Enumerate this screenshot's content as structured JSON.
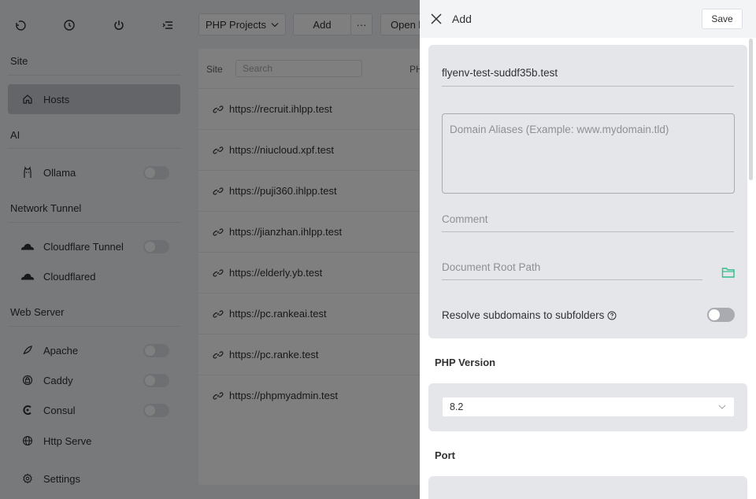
{
  "sidebar": {
    "sections": [
      {
        "label": "Site"
      },
      {
        "label": "AI"
      },
      {
        "label": "Network Tunnel"
      },
      {
        "label": "Web Server"
      }
    ],
    "items": [
      {
        "label": "Hosts",
        "icon": "home-icon"
      },
      {
        "label": "Ollama",
        "icon": "ollama-icon"
      },
      {
        "label": "Cloudflare Tunnel",
        "icon": "cloud-icon"
      },
      {
        "label": "Cloudflared",
        "icon": "cloud-icon"
      },
      {
        "label": "Apache",
        "icon": "feather-icon"
      },
      {
        "label": "Caddy",
        "icon": "caddy-icon"
      },
      {
        "label": "Consul",
        "icon": "consul-icon"
      },
      {
        "label": "Http Serve",
        "icon": "globe-icon"
      },
      {
        "label": "Settings",
        "icon": "gear-icon"
      }
    ]
  },
  "toolbar": {
    "project_select": "PHP Projects",
    "add_label": "Add",
    "more_label": "···",
    "open_label": "Open h"
  },
  "table": {
    "site_header": "Site",
    "search_placeholder": "Search",
    "php_header": "PH",
    "rows": [
      "https://recruit.ihlpp.test",
      "https://niucloud.xpf.test",
      "https://puji360.ihlpp.test",
      "https://jianzhan.ihlpp.test",
      "https://elderly.yb.test",
      "https://pc.rankeai.test",
      "https://pc.ranke.test",
      "https://phpmyadmin.test"
    ]
  },
  "drawer": {
    "title": "Add",
    "save_label": "Save",
    "host_value": "flyenv-test-suddf35b.test",
    "aliases_placeholder": "Domain Aliases (Example: www.mydomain.tld)",
    "comment_placeholder": "Comment",
    "root_placeholder": "Document Root Path",
    "resolve_label": "Resolve subdomains to subfolders",
    "resolve_enabled": false,
    "php_section": "PHP Version",
    "php_value": "8.2",
    "port_section": "Port"
  },
  "colors": {
    "accent_green": "#2fbf8a",
    "overlay": "rgba(0,0,0,0.5)"
  }
}
